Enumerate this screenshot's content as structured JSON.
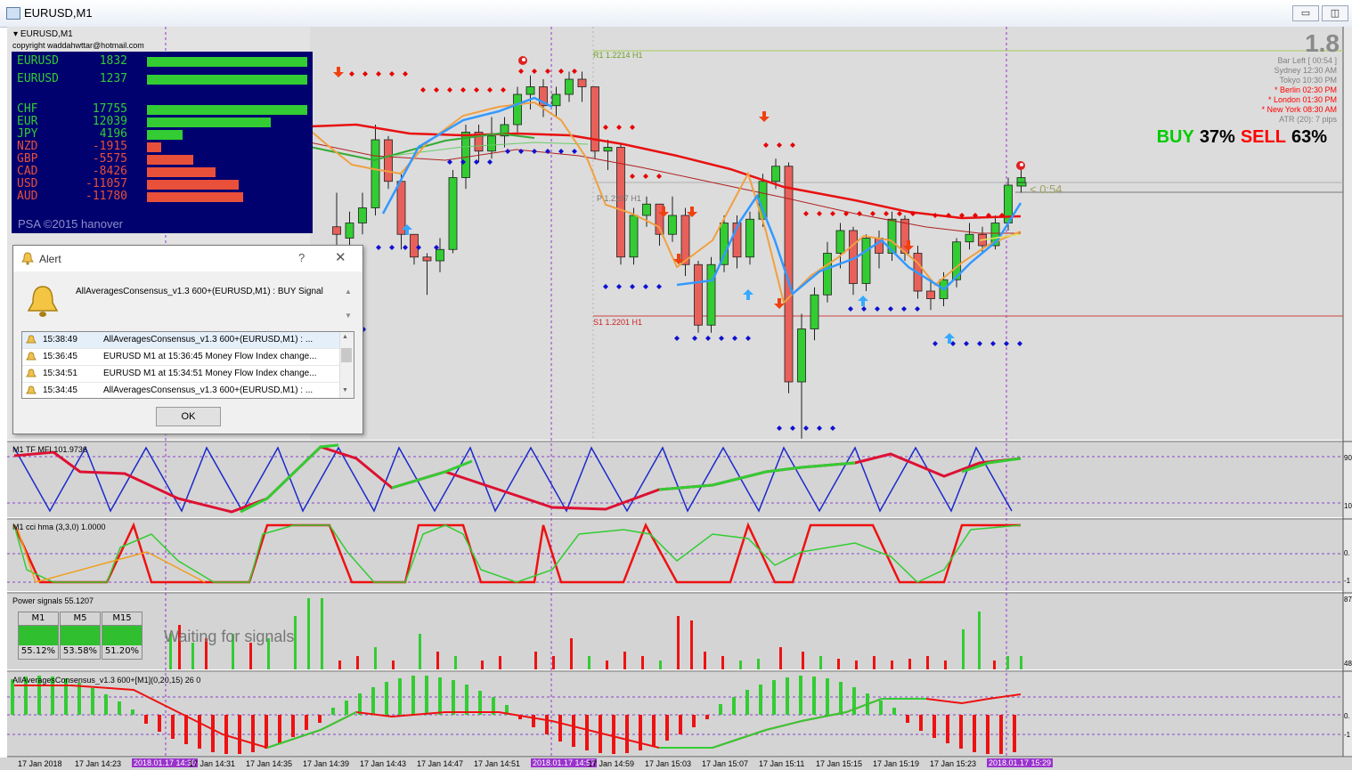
{
  "window": {
    "title": "EURUSD,M1",
    "chart_header": "EURUSD,M1",
    "copyright": "copyright waddahwttar@hotmail.com"
  },
  "strength_panel": {
    "rows": [
      {
        "name": "EURUSD",
        "value": "1832",
        "level": 1.0,
        "color": "#33cc33"
      },
      {
        "name": "EURUSD",
        "value": "1237",
        "level": 1.0,
        "color": "#33cc33"
      },
      {
        "name": "CHF",
        "value": "17755",
        "level": 1.0,
        "color": "#33cc33"
      },
      {
        "name": "EUR",
        "value": "12039",
        "level": 0.77,
        "color": "#33cc33"
      },
      {
        "name": "JPY",
        "value": "4196",
        "level": 0.22,
        "color": "#33cc33"
      },
      {
        "name": "NZD",
        "value": "-1915",
        "level": 0.09,
        "color": "#e8503a"
      },
      {
        "name": "GBP",
        "value": "-5575",
        "level": 0.29,
        "color": "#e8503a"
      },
      {
        "name": "CAD",
        "value": "-8426",
        "level": 0.43,
        "color": "#e8503a"
      },
      {
        "name": "USD",
        "value": "-11057",
        "level": 0.57,
        "color": "#e8503a"
      },
      {
        "name": "AUD",
        "value": "-11780",
        "level": 0.6,
        "color": "#e8503a"
      }
    ],
    "footer": "PSA ©2015 hanover"
  },
  "info_panel": {
    "big_value": "1.8",
    "bar_left_label": "Bar Left",
    "bar_left_value": "[ 00:54 ]",
    "sessions": [
      {
        "name": "Sydney",
        "time": "12:30 AM",
        "color": "#808080"
      },
      {
        "name": "Tokyo",
        "time": "10:30 PM",
        "color": "#808080"
      },
      {
        "name": "* Berlin",
        "time": "02:30 PM",
        "color": "#ff0000"
      },
      {
        "name": "* London",
        "time": "01:30 PM",
        "color": "#ff0000"
      },
      {
        "name": "* New York",
        "time": "08:30 AM",
        "color": "#ff0000"
      }
    ],
    "atr": "ATR (20): 7 pips",
    "buy_label": "BUY",
    "buy_pct": "37%",
    "sell_label": "SELL",
    "sell_pct": "63%",
    "timer": "< 0:54"
  },
  "pivots": {
    "r1": "R1 1.2214 H1",
    "p": "P 1.2207 H1",
    "s1": "S1 1.2201 H1"
  },
  "subwindows": {
    "mfi_label": "M1 TF MFI 101.9736",
    "cci_label": "M1 cci hma (3,3,0) 1.0000",
    "power_label": "Power signals 55.1207",
    "consensus_label": "AllAveragesConsensus_v1.3 600+[M1](0,20,15) 26 0"
  },
  "axis_numbers": [
    "90",
    "10",
    "0.",
    "-1",
    "87",
    "48",
    "0.",
    "-1"
  ],
  "power_signals": {
    "status": "Waiting for signals",
    "timeframes": [
      {
        "label": "M1",
        "pct": "55.12%"
      },
      {
        "label": "M5",
        "pct": "53.58%"
      },
      {
        "label": "M15",
        "pct": "51.20%"
      }
    ]
  },
  "time_axis": [
    {
      "label": "17 Jan 2018",
      "hl": false
    },
    {
      "label": "17 Jan 14:23",
      "hl": false
    },
    {
      "label": "2018.01.17 14:30",
      "hl": true
    },
    {
      "label": "17 Jan 14:31",
      "hl": false
    },
    {
      "label": "17 Jan 14:35",
      "hl": false
    },
    {
      "label": "17 Jan 14:39",
      "hl": false
    },
    {
      "label": "17 Jan 14:43",
      "hl": false
    },
    {
      "label": "17 Jan 14:47",
      "hl": false
    },
    {
      "label": "17 Jan 14:51",
      "hl": false
    },
    {
      "label": "2018.01.17 14:57",
      "hl": true
    },
    {
      "label": "17 Jan 14:59",
      "hl": false
    },
    {
      "label": "17 Jan 15:03",
      "hl": false
    },
    {
      "label": "17 Jan 15:07",
      "hl": false
    },
    {
      "label": "17 Jan 15:11",
      "hl": false
    },
    {
      "label": "17 Jan 15:15",
      "hl": false
    },
    {
      "label": "17 Jan 15:19",
      "hl": false
    },
    {
      "label": "17 Jan 15:23",
      "hl": false
    },
    {
      "label": "2018.01.17 15:29",
      "hl": true
    }
  ],
  "alert": {
    "title": "Alert",
    "question_mark": "?",
    "close_glyph": "✕",
    "message": "AllAveragesConsensus_v1.3 600+(EURUSD,M1) : BUY Signal",
    "items": [
      {
        "time": "15:38:49",
        "text": "AllAveragesConsensus_v1.3 600+(EURUSD,M1) : ..."
      },
      {
        "time": "15:36:45",
        "text": "EURUSD M1 at 15:36:45 Money Flow Index change..."
      },
      {
        "time": "15:34:51",
        "text": "EURUSD M1 at 15:34:51 Money Flow Index change..."
      },
      {
        "time": "15:34:45",
        "text": "AllAveragesConsensus_v1.3 600+(EURUSD,M1) : ..."
      }
    ],
    "ok_label": "OK"
  },
  "chart_data": {
    "type": "candlestick",
    "candles": [
      [
        43,
        52,
        38,
        41
      ],
      [
        40,
        47,
        37,
        44
      ],
      [
        44,
        52,
        41,
        48
      ],
      [
        48,
        70,
        46,
        66
      ],
      [
        66,
        67,
        53,
        55
      ],
      [
        55,
        57,
        37,
        41
      ],
      [
        41,
        41,
        33,
        35
      ],
      [
        35,
        36,
        25,
        34
      ],
      [
        34,
        40,
        31,
        37
      ],
      [
        37,
        58,
        36,
        56
      ],
      [
        56,
        70,
        53,
        68
      ],
      [
        68,
        70,
        60,
        63
      ],
      [
        63,
        72,
        61,
        67
      ],
      [
        67,
        72,
        64,
        70
      ],
      [
        70,
        80,
        68,
        78
      ],
      [
        78,
        83,
        74,
        80
      ],
      [
        80,
        82,
        72,
        75
      ],
      [
        75,
        80,
        72,
        78
      ],
      [
        78,
        84,
        76,
        82
      ],
      [
        82,
        84,
        76,
        80
      ],
      [
        80,
        80,
        61,
        63
      ],
      [
        63,
        66,
        58,
        64
      ],
      [
        64,
        65,
        33,
        35
      ],
      [
        35,
        48,
        33,
        46
      ],
      [
        46,
        51,
        43,
        49
      ],
      [
        49,
        49,
        38,
        41
      ],
      [
        41,
        51,
        39,
        46
      ],
      [
        46,
        48,
        30,
        33
      ],
      [
        33,
        34,
        15,
        17
      ],
      [
        17,
        35,
        15,
        33
      ],
      [
        33,
        46,
        31,
        44
      ],
      [
        44,
        46,
        32,
        35
      ],
      [
        35,
        47,
        33,
        45
      ],
      [
        45,
        57,
        43,
        55
      ],
      [
        55,
        61,
        53,
        59
      ],
      [
        59,
        60,
        -1,
        2
      ],
      [
        2,
        20,
        -13,
        16
      ],
      [
        16,
        27,
        13,
        25
      ],
      [
        25,
        39,
        23,
        36
      ],
      [
        36,
        44,
        32,
        42
      ],
      [
        42,
        43,
        25,
        28
      ],
      [
        28,
        41,
        26,
        40
      ],
      [
        40,
        42,
        32,
        36
      ],
      [
        36,
        47,
        34,
        45
      ],
      [
        45,
        46,
        34,
        36
      ],
      [
        36,
        38,
        24,
        26
      ],
      [
        26,
        29,
        21,
        24
      ],
      [
        24,
        31,
        22,
        29
      ],
      [
        29,
        40,
        27,
        39
      ],
      [
        39,
        44,
        37,
        41
      ],
      [
        41,
        43,
        36,
        38
      ],
      [
        38,
        46,
        37,
        44
      ],
      [
        44,
        56,
        42,
        54
      ],
      [
        54,
        58,
        52,
        56
      ]
    ],
    "ylim": [
      -10,
      90
    ]
  }
}
